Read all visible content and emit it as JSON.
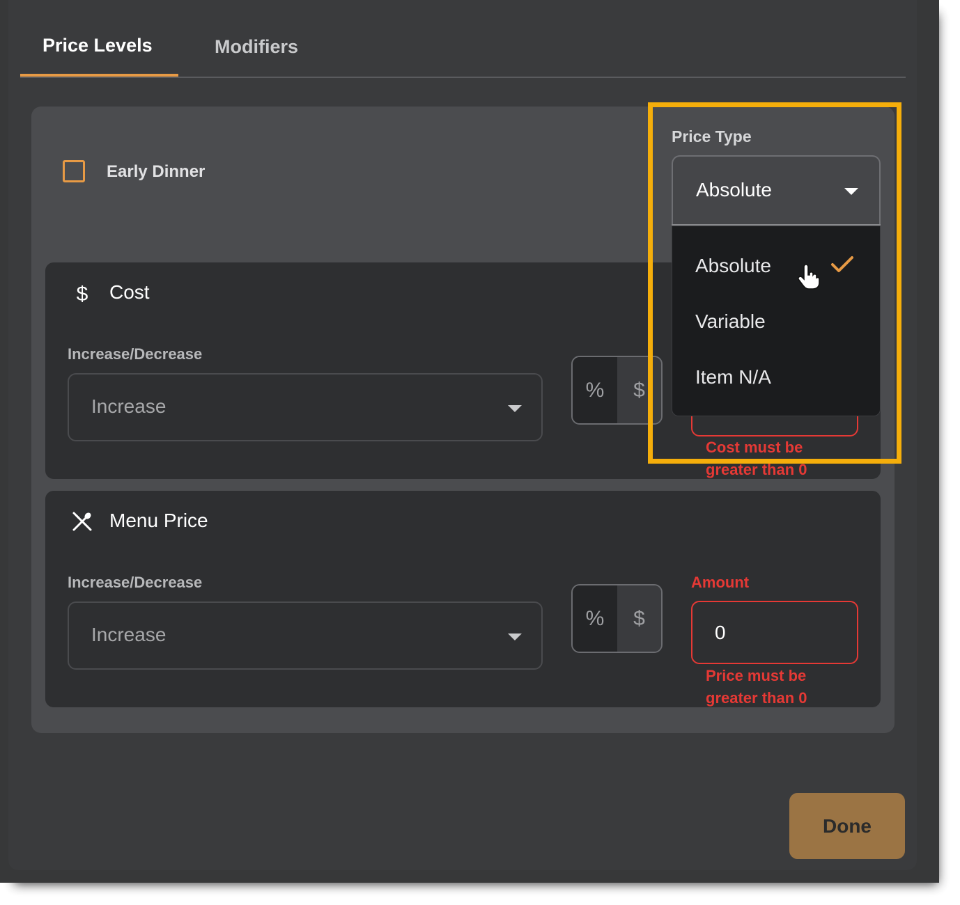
{
  "tabs": [
    {
      "label": "Price Levels",
      "active": true
    },
    {
      "label": "Modifiers",
      "active": false
    }
  ],
  "level": {
    "label": "Early Dinner",
    "checked": false
  },
  "price_type": {
    "label": "Price Type",
    "selected": "Absolute",
    "options": [
      {
        "label": "Absolute",
        "selected": true
      },
      {
        "label": "Variable",
        "selected": false
      },
      {
        "label": "Item N/A",
        "selected": false
      }
    ]
  },
  "cost": {
    "title": "Cost",
    "icon": "dollar-icon",
    "direction_label": "Increase/Decrease",
    "direction_value": "Increase",
    "toggle": {
      "percent": "%",
      "dollar": "$"
    },
    "error": "Cost must be greater than 0"
  },
  "menu_price": {
    "title": "Menu Price",
    "icon": "utensils-icon",
    "direction_label": "Increase/Decrease",
    "direction_value": "Increase",
    "toggle": {
      "percent": "%",
      "dollar": "$"
    },
    "amount_label": "Amount",
    "amount_value": "0",
    "error": "Price must be greater than 0"
  },
  "done_label": "Done",
  "colors": {
    "accent": "#e79a45",
    "error": "#e53935",
    "highlight": "#f5ae0b",
    "done_button": "#9b7444"
  }
}
